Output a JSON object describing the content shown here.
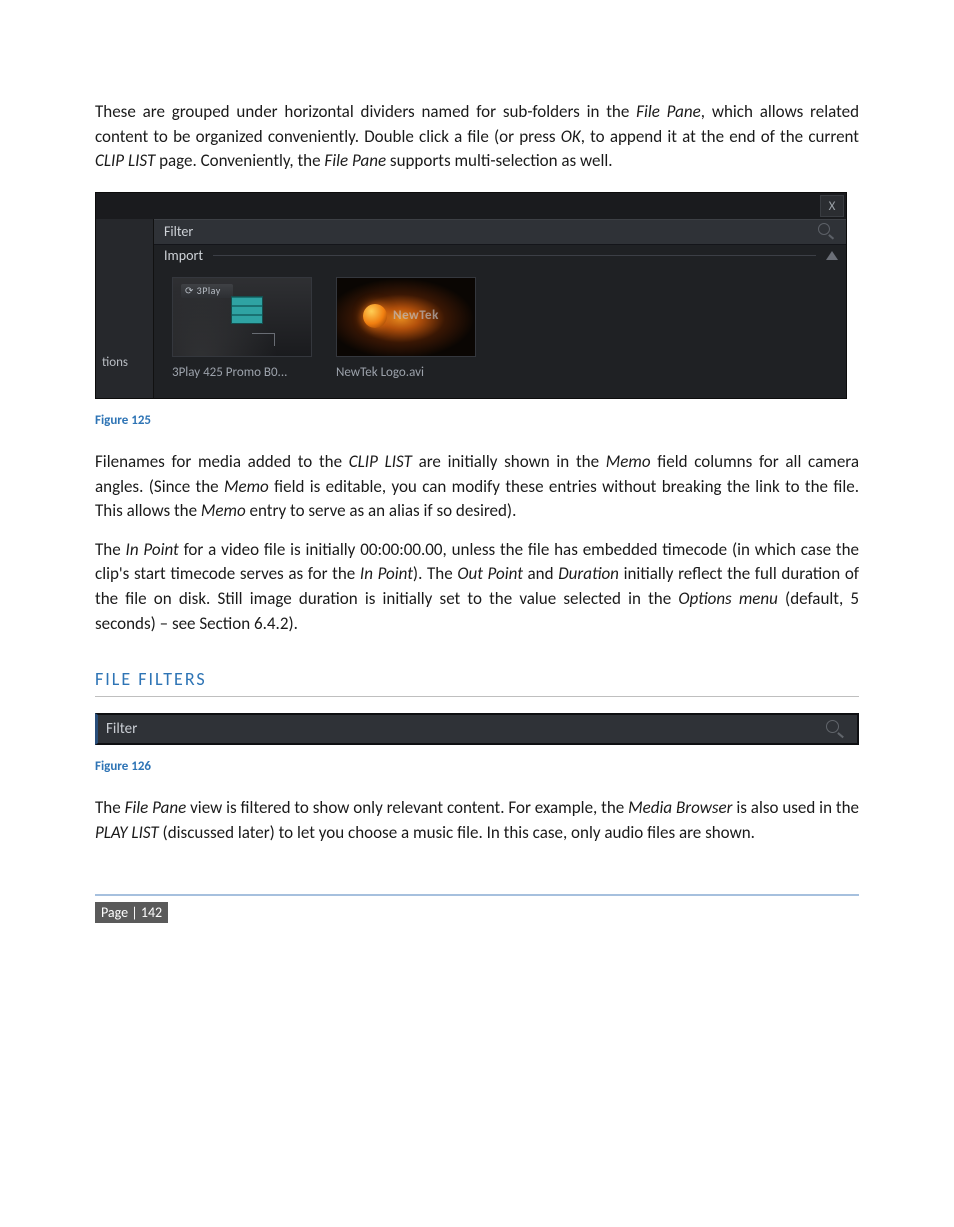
{
  "paragraphs": {
    "p1": {
      "a": "These are grouped under horizontal dividers named for sub-folders in the ",
      "b": "File Pane",
      "c": ", which allows related content to be organized conveniently.  Double click a file (or press ",
      "d": "OK",
      "e": ", to append it at the end of the current ",
      "f": "CLIP LIST",
      "g": " page.  Conveniently, the ",
      "h": "File Pane",
      "i": " supports multi-selection as well."
    },
    "p2": {
      "a": "Filenames for media added to the ",
      "b": "CLIP LIST",
      "c": " are initially shown in the ",
      "d": "Memo",
      "e": " field columns for all camera angles.  (Since the ",
      "f": "Memo",
      "g": " field is editable, you can modify these entries without breaking the link to the file.  This allows the ",
      "h": "Memo",
      "i": " entry to serve as an alias if so desired)."
    },
    "p3": {
      "a": "The ",
      "b": "In Point",
      "c": " for a video file is initially 00:00:00.00, unless the file has embedded timecode (in which case the clip's start timecode serves as for the ",
      "d": "In Point",
      "e": ").   The ",
      "f": "Out Point",
      "g": " and ",
      "h": "Duration",
      "i": " initially reflect the full duration of the file on disk.  Still image duration is initially set to the value selected in the ",
      "j": "Options menu",
      "k": " (default, 5 seconds) – see Section 6.4.2)."
    },
    "p4": {
      "a": "The ",
      "b": "File Pane",
      "c": " view is filtered to show only relevant content. For example, the ",
      "d": "Media Browser",
      "e": " is also used in the ",
      "f": "PLAY LIST",
      "g": " (discussed later) to let you choose a music file.  In this case, only audio files are shown."
    }
  },
  "ui125": {
    "close": "X",
    "leftTab": "tions",
    "filterLabel": "Filter",
    "sectionLabel": "Import",
    "thumb1Mark": "⟳ 3Play",
    "thumb1Caption": "3Play 425 Promo B0...",
    "thumb2Text": "NewTek",
    "thumb2Caption": "NewTek Logo.avi"
  },
  "captions": {
    "fig125": "Figure 125",
    "fig126": "Figure 126"
  },
  "headings": {
    "fileFilters": "FILE FILTERS"
  },
  "ui126": {
    "filterLabel": "Filter"
  },
  "footer": {
    "pageLabel": "Page | 142"
  }
}
